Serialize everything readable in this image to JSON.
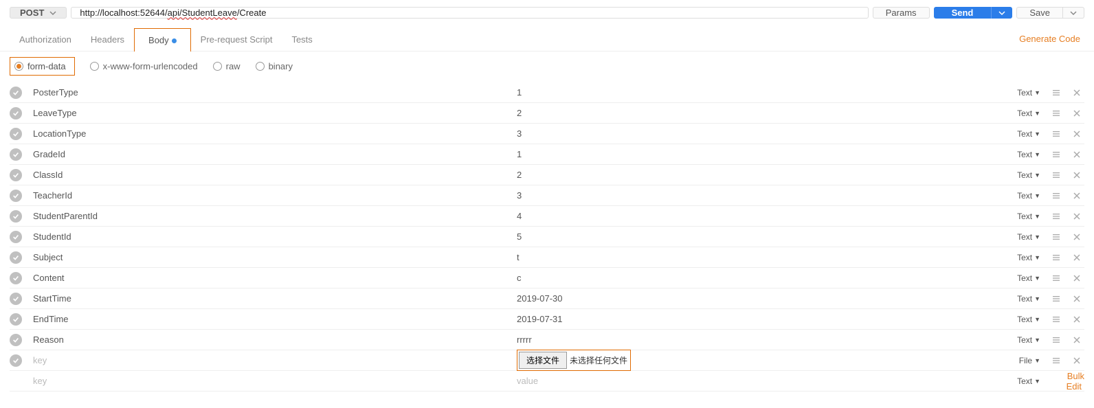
{
  "method": "POST",
  "url_plain": "http://localhost:52644/",
  "url_redpath": "api/StudentLeave",
  "url_tail": "/Create",
  "buttons": {
    "params": "Params",
    "send": "Send",
    "save": "Save"
  },
  "tabs": {
    "authorization": "Authorization",
    "headers": "Headers",
    "body": "Body",
    "pre_request": "Pre-request Script",
    "tests": "Tests",
    "generate_code": "Generate Code"
  },
  "body_types": {
    "form_data": "form-data",
    "urlencoded": "x-www-form-urlencoded",
    "raw": "raw",
    "binary": "binary"
  },
  "type_labels": {
    "text": "Text",
    "file": "File"
  },
  "placeholders": {
    "key": "key",
    "value": "value"
  },
  "file_picker": {
    "button": "选择文件",
    "status": "未选择任何文件"
  },
  "bulk_edit": "Bulk Edit",
  "rows": [
    {
      "key": "PosterType",
      "value": "1",
      "type": "Text",
      "checked": true
    },
    {
      "key": "LeaveType",
      "value": "2",
      "type": "Text",
      "checked": true
    },
    {
      "key": "LocationType",
      "value": "3",
      "type": "Text",
      "checked": true
    },
    {
      "key": "GradeId",
      "value": "1",
      "type": "Text",
      "checked": true
    },
    {
      "key": "ClassId",
      "value": "2",
      "type": "Text",
      "checked": true
    },
    {
      "key": "TeacherId",
      "value": "3",
      "type": "Text",
      "checked": true
    },
    {
      "key": "StudentParentId",
      "value": "4",
      "type": "Text",
      "checked": true
    },
    {
      "key": "StudentId",
      "value": "5",
      "type": "Text",
      "checked": true
    },
    {
      "key": "Subject",
      "value": "t",
      "type": "Text",
      "checked": true
    },
    {
      "key": "Content",
      "value": "c",
      "type": "Text",
      "checked": true
    },
    {
      "key": "StartTime",
      "value": "2019-07-30",
      "type": "Text",
      "checked": true
    },
    {
      "key": "EndTime",
      "value": "2019-07-31",
      "type": "Text",
      "checked": true
    },
    {
      "key": "Reason",
      "value": "rrrrr",
      "type": "Text",
      "checked": true
    }
  ]
}
